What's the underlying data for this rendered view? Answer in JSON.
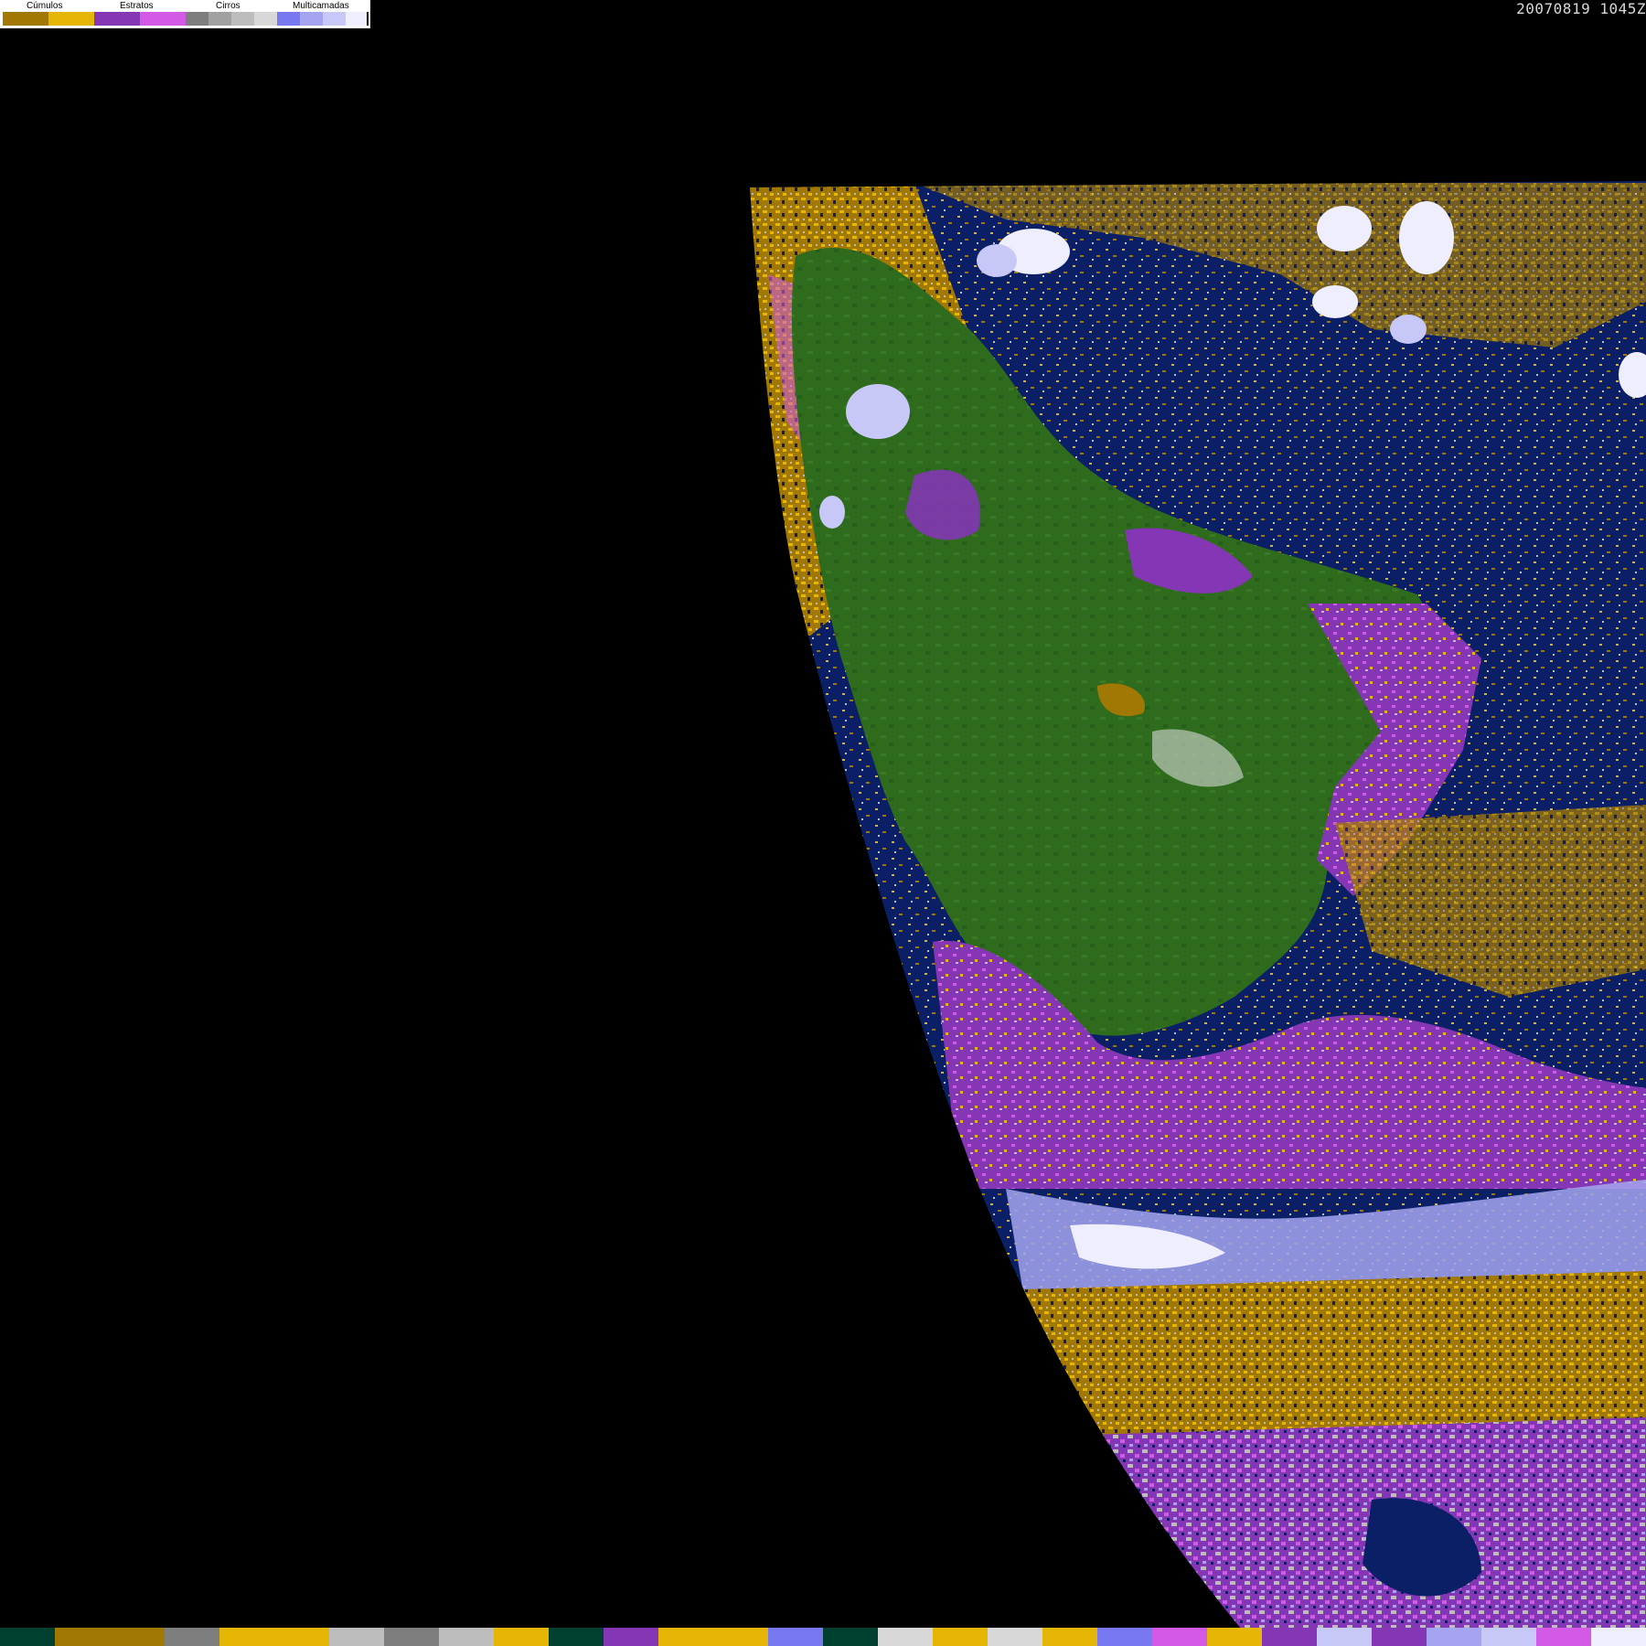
{
  "legend": {
    "groups": [
      {
        "label": "Cúmulos",
        "colors": [
          "#a27805",
          "#e6b606"
        ]
      },
      {
        "label": "Estratos",
        "colors": [
          "#8436b4",
          "#d25ae6"
        ]
      },
      {
        "label": "Cirros",
        "colors": [
          "#7e7e7e",
          "#a1a1a1",
          "#bdbdbd",
          "#d8d8d8"
        ]
      },
      {
        "label": "Multicamadas",
        "colors": [
          "#7878f0",
          "#a4a4f0",
          "#c8c8f8",
          "#eeeeff"
        ]
      }
    ]
  },
  "timestamp": "20070819 1045Z",
  "colors": {
    "background": "#000000",
    "ocean": "#0a1f66",
    "land": "#2f6b1c",
    "land_dark": "#1f5a14",
    "cumulus_low": "#a27805",
    "cumulus_high": "#e6b606",
    "stratus": "#8436b4",
    "stratus_light": "#d25ae6",
    "cirrus": "#bdbdbd",
    "multilayer": "#c8c8f8"
  },
  "bottom_strip": [
    "#004030",
    "#a27805",
    "#a27805",
    "#7e7e7e",
    "#e6b606",
    "#e6b606",
    "#bdbdbd",
    "#7e7e7e",
    "#bdbdbd",
    "#e6b606",
    "#004030",
    "#8436b4",
    "#e6b606",
    "#e6b606",
    "#7878f0",
    "#004030",
    "#d8d8d8",
    "#e6b606",
    "#d8d8d8",
    "#e6b606",
    "#7878f0",
    "#d25ae6",
    "#e6b606",
    "#8436b4",
    "#c8c8f8",
    "#8436b4",
    "#a4a4f0",
    "#c8c8f8",
    "#d25ae6",
    "#eeeeff"
  ]
}
